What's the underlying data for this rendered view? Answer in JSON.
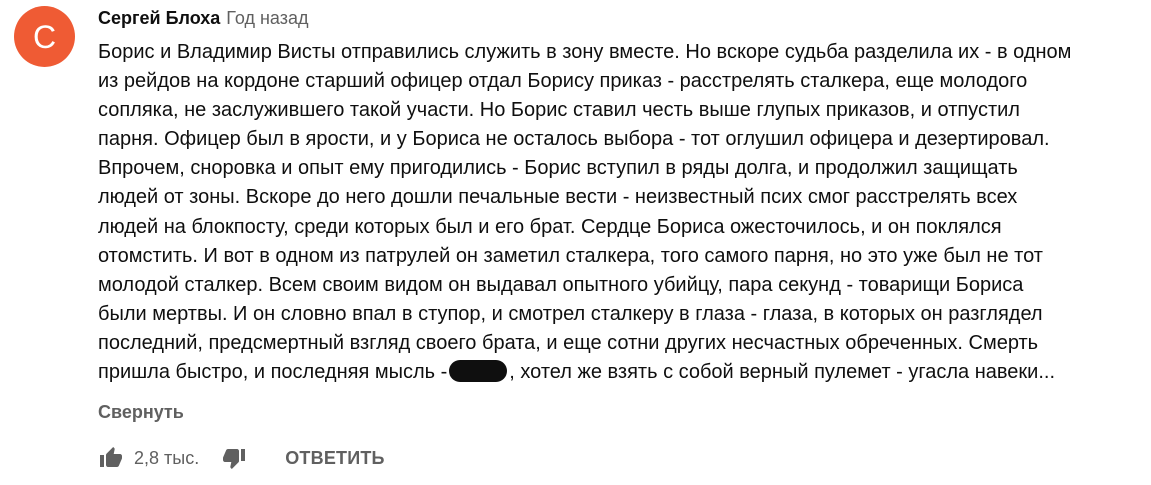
{
  "avatar": {
    "letter": "С",
    "color": "#ef5b34"
  },
  "comment": {
    "author": "Сергей Блоха",
    "time": "Год назад",
    "lines": [
      "Борис и Владимир Висты отправились служить в зону вместе. Но вскоре судьба разделила их - в одном",
      "из рейдов на кордоне старший офицер отдал Борису приказ - расстрелять сталкера, еще молодого",
      "сопляка, не заслужившего такой участи. Но Борис ставил честь выше глупых приказов, и отпустил",
      "парня. Офицер был в ярости, и у Бориса не осталось выбора - тот оглушил офицера и дезертировал.",
      "Впрочем, сноровка и опыт ему пригодились - Борис вступил в ряды долга, и продолжил защищать",
      "людей от зоны. Вскоре до него дошли печальные вести - неизвестный псих смог расстрелять всех",
      "людей на блокпосту, среди которых был и его брат. Сердце Бориса ожесточилось, и он поклялся",
      "отомстить. И вот в одном из патрулей он заметил сталкера, того самого парня, но это уже был не тот",
      "молодой сталкер. Всем своим видом он выдавал опытного убийцу, пара секунд - товарищи Бориса",
      "были мертвы. И он словно впал в ступор, и смотрел сталкеру в глаза - глаза, в которых он разглядел",
      "последний, предсмертный взгляд своего брата, и еще сотни других несчастных обреченных. Смерть"
    ],
    "last_line_before": "пришла быстро, и последняя мысль -",
    "last_line_after": ", хотел же взять с собой верный пулемет - угасла навеки..."
  },
  "collapse_label": "Свернуть",
  "actions": {
    "like_icon": "thumb-up-icon",
    "like_count": "2,8 тыс.",
    "dislike_icon": "thumb-down-icon",
    "reply_label": "ОТВЕТИТЬ"
  }
}
